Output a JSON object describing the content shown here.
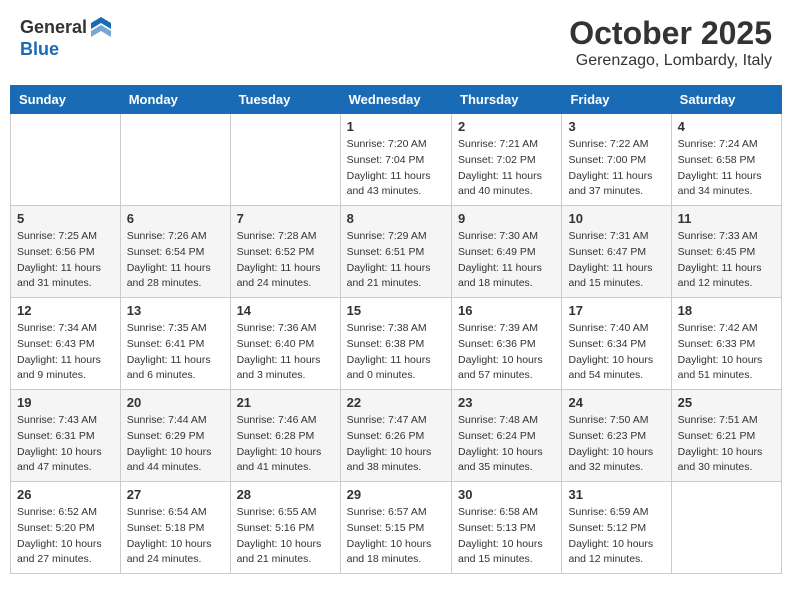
{
  "header": {
    "logo_general": "General",
    "logo_blue": "Blue",
    "month": "October 2025",
    "location": "Gerenzago, Lombardy, Italy"
  },
  "weekdays": [
    "Sunday",
    "Monday",
    "Tuesday",
    "Wednesday",
    "Thursday",
    "Friday",
    "Saturday"
  ],
  "weeks": [
    [
      {
        "day": "",
        "info": ""
      },
      {
        "day": "",
        "info": ""
      },
      {
        "day": "",
        "info": ""
      },
      {
        "day": "1",
        "info": "Sunrise: 7:20 AM\nSunset: 7:04 PM\nDaylight: 11 hours\nand 43 minutes."
      },
      {
        "day": "2",
        "info": "Sunrise: 7:21 AM\nSunset: 7:02 PM\nDaylight: 11 hours\nand 40 minutes."
      },
      {
        "day": "3",
        "info": "Sunrise: 7:22 AM\nSunset: 7:00 PM\nDaylight: 11 hours\nand 37 minutes."
      },
      {
        "day": "4",
        "info": "Sunrise: 7:24 AM\nSunset: 6:58 PM\nDaylight: 11 hours\nand 34 minutes."
      }
    ],
    [
      {
        "day": "5",
        "info": "Sunrise: 7:25 AM\nSunset: 6:56 PM\nDaylight: 11 hours\nand 31 minutes."
      },
      {
        "day": "6",
        "info": "Sunrise: 7:26 AM\nSunset: 6:54 PM\nDaylight: 11 hours\nand 28 minutes."
      },
      {
        "day": "7",
        "info": "Sunrise: 7:28 AM\nSunset: 6:52 PM\nDaylight: 11 hours\nand 24 minutes."
      },
      {
        "day": "8",
        "info": "Sunrise: 7:29 AM\nSunset: 6:51 PM\nDaylight: 11 hours\nand 21 minutes."
      },
      {
        "day": "9",
        "info": "Sunrise: 7:30 AM\nSunset: 6:49 PM\nDaylight: 11 hours\nand 18 minutes."
      },
      {
        "day": "10",
        "info": "Sunrise: 7:31 AM\nSunset: 6:47 PM\nDaylight: 11 hours\nand 15 minutes."
      },
      {
        "day": "11",
        "info": "Sunrise: 7:33 AM\nSunset: 6:45 PM\nDaylight: 11 hours\nand 12 minutes."
      }
    ],
    [
      {
        "day": "12",
        "info": "Sunrise: 7:34 AM\nSunset: 6:43 PM\nDaylight: 11 hours\nand 9 minutes."
      },
      {
        "day": "13",
        "info": "Sunrise: 7:35 AM\nSunset: 6:41 PM\nDaylight: 11 hours\nand 6 minutes."
      },
      {
        "day": "14",
        "info": "Sunrise: 7:36 AM\nSunset: 6:40 PM\nDaylight: 11 hours\nand 3 minutes."
      },
      {
        "day": "15",
        "info": "Sunrise: 7:38 AM\nSunset: 6:38 PM\nDaylight: 11 hours\nand 0 minutes."
      },
      {
        "day": "16",
        "info": "Sunrise: 7:39 AM\nSunset: 6:36 PM\nDaylight: 10 hours\nand 57 minutes."
      },
      {
        "day": "17",
        "info": "Sunrise: 7:40 AM\nSunset: 6:34 PM\nDaylight: 10 hours\nand 54 minutes."
      },
      {
        "day": "18",
        "info": "Sunrise: 7:42 AM\nSunset: 6:33 PM\nDaylight: 10 hours\nand 51 minutes."
      }
    ],
    [
      {
        "day": "19",
        "info": "Sunrise: 7:43 AM\nSunset: 6:31 PM\nDaylight: 10 hours\nand 47 minutes."
      },
      {
        "day": "20",
        "info": "Sunrise: 7:44 AM\nSunset: 6:29 PM\nDaylight: 10 hours\nand 44 minutes."
      },
      {
        "day": "21",
        "info": "Sunrise: 7:46 AM\nSunset: 6:28 PM\nDaylight: 10 hours\nand 41 minutes."
      },
      {
        "day": "22",
        "info": "Sunrise: 7:47 AM\nSunset: 6:26 PM\nDaylight: 10 hours\nand 38 minutes."
      },
      {
        "day": "23",
        "info": "Sunrise: 7:48 AM\nSunset: 6:24 PM\nDaylight: 10 hours\nand 35 minutes."
      },
      {
        "day": "24",
        "info": "Sunrise: 7:50 AM\nSunset: 6:23 PM\nDaylight: 10 hours\nand 32 minutes."
      },
      {
        "day": "25",
        "info": "Sunrise: 7:51 AM\nSunset: 6:21 PM\nDaylight: 10 hours\nand 30 minutes."
      }
    ],
    [
      {
        "day": "26",
        "info": "Sunrise: 6:52 AM\nSunset: 5:20 PM\nDaylight: 10 hours\nand 27 minutes."
      },
      {
        "day": "27",
        "info": "Sunrise: 6:54 AM\nSunset: 5:18 PM\nDaylight: 10 hours\nand 24 minutes."
      },
      {
        "day": "28",
        "info": "Sunrise: 6:55 AM\nSunset: 5:16 PM\nDaylight: 10 hours\nand 21 minutes."
      },
      {
        "day": "29",
        "info": "Sunrise: 6:57 AM\nSunset: 5:15 PM\nDaylight: 10 hours\nand 18 minutes."
      },
      {
        "day": "30",
        "info": "Sunrise: 6:58 AM\nSunset: 5:13 PM\nDaylight: 10 hours\nand 15 minutes."
      },
      {
        "day": "31",
        "info": "Sunrise: 6:59 AM\nSunset: 5:12 PM\nDaylight: 10 hours\nand 12 minutes."
      },
      {
        "day": "",
        "info": ""
      }
    ]
  ]
}
